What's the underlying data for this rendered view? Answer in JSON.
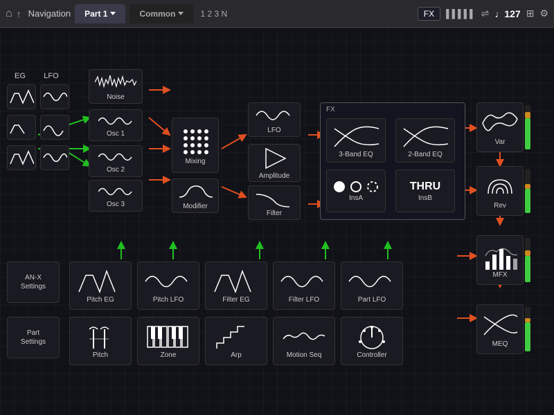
{
  "topbar": {
    "nav_label": "Navigation",
    "tab_part1": "Part 1",
    "tab_common": "Common",
    "seq_labels": "1 2 3 N",
    "fx_btn": "FX",
    "tempo": "♩127",
    "home_icon": "⌂",
    "up_icon": "↑",
    "midi_icon": "≡≡≡",
    "usb_icon": "⇌",
    "grid_icon": "⊞",
    "gear_icon": "⚙"
  },
  "modules": {
    "eg": "EG",
    "lfo": "LFO",
    "noise": "Noise",
    "osc1": "Osc 1",
    "osc2": "Osc 2",
    "osc3": "Osc 3",
    "mixing": "Mixing",
    "modifier": "Modifier",
    "lfo_main": "LFO",
    "amplitude": "Amplitude",
    "filter": "Filter",
    "fx_label": "FX",
    "eq3band": "3-Band EQ",
    "eq2band": "2-Band EQ",
    "insA": "InsA",
    "insB": "InsB",
    "thru": "THRU",
    "var": "Var",
    "rev": "Rev",
    "mfx": "MFX",
    "meq": "MEQ",
    "pitch_eg": "Pitch EG",
    "pitch_lfo": "Pitch LFO",
    "filter_eg": "Filter EG",
    "filter_lfo": "Filter LFO",
    "part_lfo": "Part LFO",
    "an_x_settings": "AN-X\nSettings",
    "part_settings": "Part\nSettings",
    "pitch": "Pitch",
    "zone": "Zone",
    "arp": "Arp",
    "motion_seq": "Motion Seq",
    "controller": "Controller"
  },
  "colors": {
    "red_arrow": "#e05020",
    "green_arrow": "#20c020",
    "module_bg": "#1a1a22",
    "module_border": "#333",
    "fx_bg": "#141420",
    "level_green": "#40cc40",
    "level_orange": "#cc8820"
  }
}
